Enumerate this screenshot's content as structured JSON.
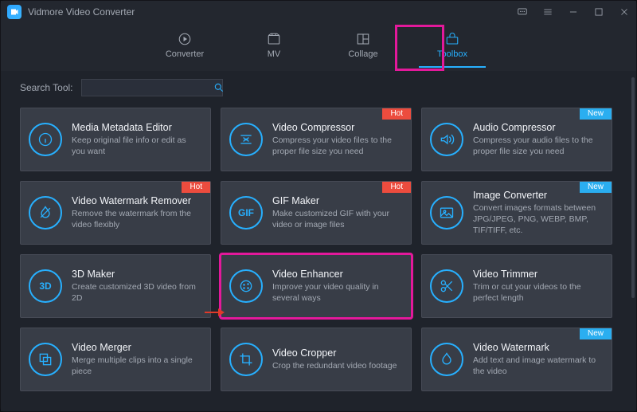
{
  "app": {
    "title": "Vidmore Video Converter"
  },
  "nav": {
    "tabs": [
      {
        "id": "converter",
        "label": "Converter"
      },
      {
        "id": "mv",
        "label": "MV"
      },
      {
        "id": "collage",
        "label": "Collage"
      },
      {
        "id": "toolbox",
        "label": "Toolbox"
      }
    ],
    "active_index": 3
  },
  "search": {
    "label": "Search Tool:",
    "value": "",
    "placeholder": ""
  },
  "badges": {
    "hot": "Hot",
    "new": "New"
  },
  "tools": [
    {
      "id": "media-metadata-editor",
      "title": "Media Metadata Editor",
      "desc": "Keep original file info or edit as you want",
      "badge": null,
      "highlight": false
    },
    {
      "id": "video-compressor",
      "title": "Video Compressor",
      "desc": "Compress your video files to the proper file size you need",
      "badge": "hot",
      "highlight": false
    },
    {
      "id": "audio-compressor",
      "title": "Audio Compressor",
      "desc": "Compress your audio files to the proper file size you need",
      "badge": "new",
      "highlight": false
    },
    {
      "id": "video-watermark-remover",
      "title": "Video Watermark Remover",
      "desc": "Remove the watermark from the video flexibly",
      "badge": "hot",
      "highlight": false
    },
    {
      "id": "gif-maker",
      "title": "GIF Maker",
      "desc": "Make customized GIF with your video or image files",
      "badge": "hot",
      "highlight": false
    },
    {
      "id": "image-converter",
      "title": "Image Converter",
      "desc": "Convert images formats between JPG/JPEG, PNG, WEBP, BMP, TIF/TIFF, etc.",
      "badge": "new",
      "highlight": false
    },
    {
      "id": "3d-maker",
      "title": "3D Maker",
      "desc": "Create customized 3D video from 2D",
      "badge": null,
      "highlight": false
    },
    {
      "id": "video-enhancer",
      "title": "Video Enhancer",
      "desc": "Improve your video quality in several ways",
      "badge": null,
      "highlight": true
    },
    {
      "id": "video-trimmer",
      "title": "Video Trimmer",
      "desc": "Trim or cut your videos to the perfect length",
      "badge": null,
      "highlight": false
    },
    {
      "id": "video-merger",
      "title": "Video Merger",
      "desc": "Merge multiple clips into a single piece",
      "badge": null,
      "highlight": false
    },
    {
      "id": "video-cropper",
      "title": "Video Cropper",
      "desc": "Crop the redundant video footage",
      "badge": null,
      "highlight": false
    },
    {
      "id": "video-watermark",
      "title": "Video Watermark",
      "desc": "Add text and image watermark to the video",
      "badge": "new",
      "highlight": false
    }
  ]
}
